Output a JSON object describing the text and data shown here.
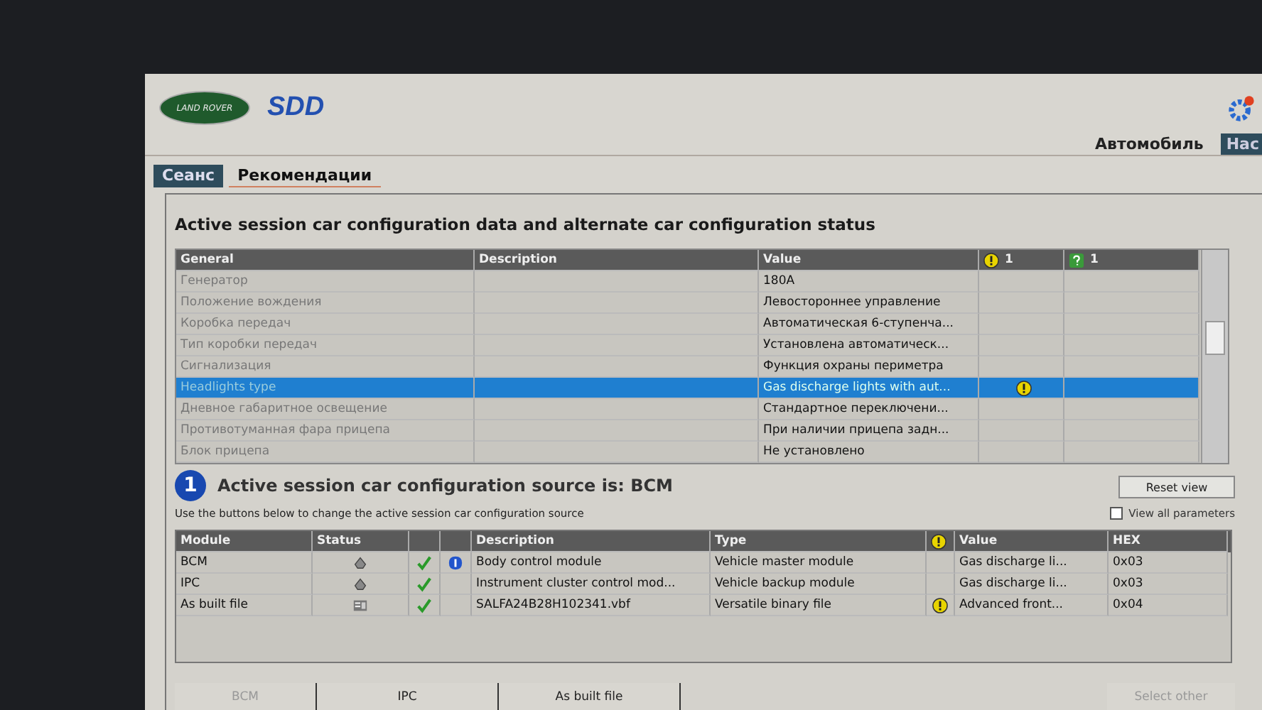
{
  "header": {
    "logo_text": "LAND ROVER",
    "app_name": "SDD",
    "nav": [
      {
        "label": "Автомобиль",
        "selected": false
      },
      {
        "label": "Нас",
        "selected": true
      }
    ]
  },
  "tabs": [
    {
      "label": "Сеанс",
      "selected": true
    },
    {
      "label": "Рекомендации",
      "selected": false
    }
  ],
  "title": "Active session car configuration data and alternate car configuration status",
  "config_table": {
    "columns": [
      {
        "label": "General",
        "kind": "text"
      },
      {
        "label": "Description",
        "kind": "text"
      },
      {
        "label": "Value",
        "kind": "text"
      },
      {
        "label": "1",
        "kind": "warning"
      },
      {
        "label": "1",
        "kind": "info"
      }
    ],
    "rows": [
      {
        "name": "Генератор",
        "value": "180A",
        "warning": false,
        "selected": false
      },
      {
        "name": "Положение вождения",
        "value": "Левостороннее управление",
        "warning": false,
        "selected": false
      },
      {
        "name": "Коробка передач",
        "value": "Автоматическая 6-ступенча...",
        "warning": false,
        "selected": false
      },
      {
        "name": "Тип коробки передач",
        "value": "Установлена автоматическ...",
        "warning": false,
        "selected": false
      },
      {
        "name": "Сигнализация",
        "value": "Функция охраны периметра",
        "warning": false,
        "selected": false
      },
      {
        "name": "Headlights type",
        "value": "Gas discharge lights with aut...",
        "warning": true,
        "selected": true
      },
      {
        "name": "Дневное габаритное освещение",
        "value": "Стандартное переключени...",
        "warning": false,
        "selected": false
      },
      {
        "name": "Противотуманная фара прицепа",
        "value": "При наличии прицепа задн...",
        "warning": false,
        "selected": false
      },
      {
        "name": "Блок прицепа",
        "value": "Не установлено",
        "warning": false,
        "selected": false
      }
    ]
  },
  "source": {
    "badge": "1",
    "heading": "Active session car configuration source is: BCM",
    "hint": "Use the buttons below to change the active session car configuration source",
    "reset_button": "Reset view",
    "view_all": {
      "label": "View all parameters",
      "checked": false
    }
  },
  "module_table": {
    "columns": [
      {
        "label": "Module",
        "kind": "text"
      },
      {
        "label": "Status",
        "kind": "text"
      },
      {
        "kind": "blank"
      },
      {
        "kind": "blank"
      },
      {
        "label": "Description",
        "kind": "text"
      },
      {
        "label": "Type",
        "kind": "text"
      },
      {
        "kind": "warning"
      },
      {
        "label": "Value",
        "kind": "text"
      },
      {
        "label": "HEX",
        "kind": "text"
      }
    ],
    "rows": [
      {
        "module": "BCM",
        "kind": "module",
        "ok": true,
        "master": true,
        "description": "Body control module",
        "type": "Vehicle master module",
        "warning": false,
        "value": "Gas discharge li...",
        "hex": "0x03"
      },
      {
        "module": "IPC",
        "kind": "module",
        "ok": true,
        "master": false,
        "description": "Instrument cluster control mod...",
        "type": "Vehicle backup module",
        "warning": false,
        "value": "Gas discharge li...",
        "hex": "0x03"
      },
      {
        "module": "As built file",
        "kind": "file",
        "ok": true,
        "master": false,
        "description": "SALFA24B28H102341.vbf",
        "type": "Versatile binary file",
        "warning": true,
        "value": "Advanced front...",
        "hex": "0x04"
      }
    ]
  },
  "source_buttons": [
    {
      "label": "BCM",
      "disabled": true
    },
    {
      "label": "IPC",
      "disabled": false
    },
    {
      "label": "As built file",
      "disabled": false
    },
    {
      "label": "Select other",
      "disabled": true
    }
  ]
}
